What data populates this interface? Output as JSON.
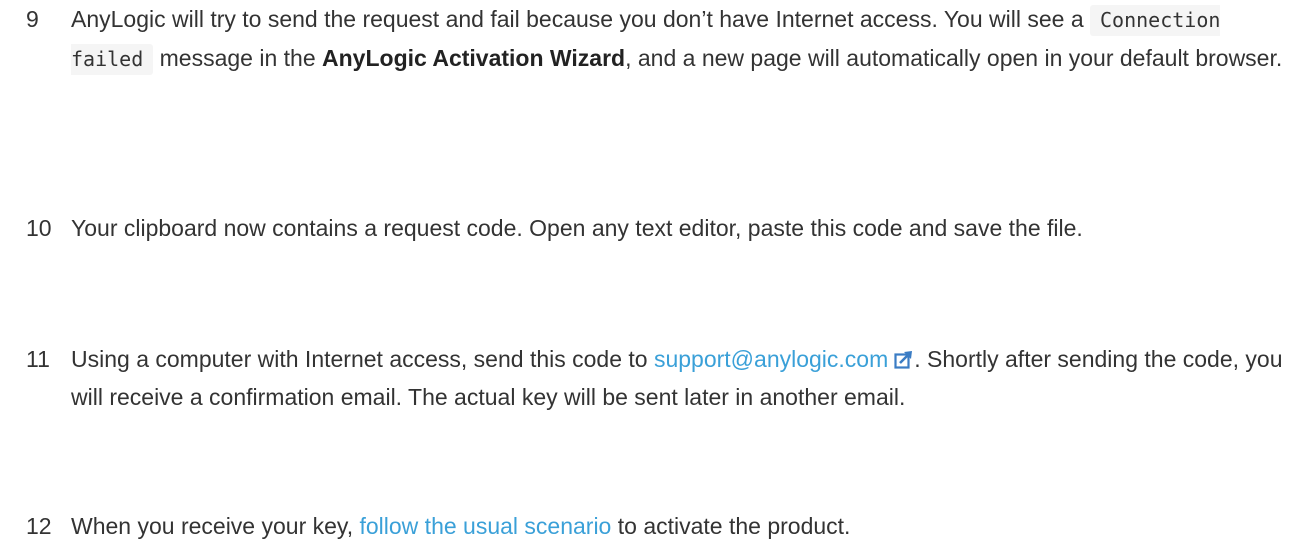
{
  "steps": [
    {
      "number": "9",
      "text_before_code": "AnyLogic will try to send the request and fail because you don’t have Internet access. You will see a ",
      "code": "Connection failed",
      "text_before_bold": " message in the ",
      "bold": "AnyLogic Activation Wizard",
      "text_after_bold": ", and a new page will automatically open in your default browser."
    },
    {
      "number": "10",
      "text": "Your clipboard now contains a request code. Open any text editor, paste this code and save the file."
    },
    {
      "number": "11",
      "text_before_link": "Using a computer with Internet access, send this code to ",
      "link": "support@anylogic.com",
      "link_icon": "external-link-icon",
      "text_after_link": ". Shortly after sending the code, you will receive a confirmation email. The actual key will be sent later in another email."
    },
    {
      "number": "12",
      "text_before_link": "When you receive your key, ",
      "link": "follow the usual scenario",
      "text_after_link": " to activate the product."
    }
  ],
  "colors": {
    "text": "#333333",
    "link": "#3aa0d8",
    "code_background": "#f5f5f5"
  }
}
